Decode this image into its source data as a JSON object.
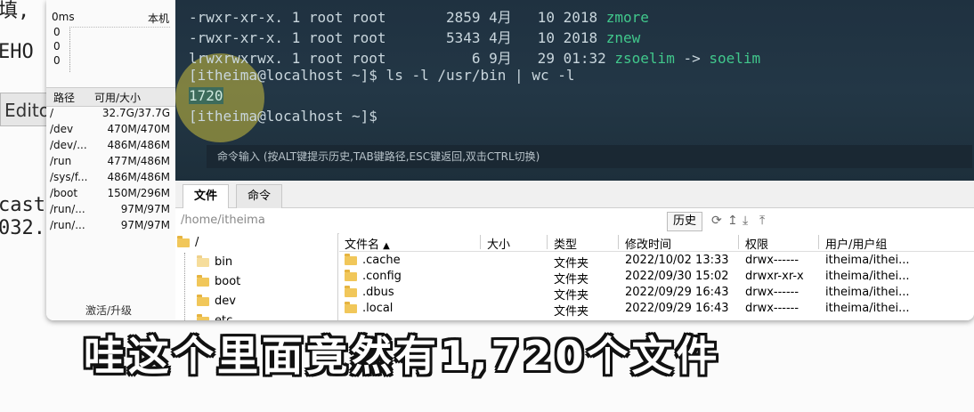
{
  "background": {
    "left_text": [
      "填,",
      "EHO",
      "cast",
      "032."
    ],
    "editor_btn": "Edito"
  },
  "sidebar": {
    "ms_label": "0ms",
    "ms_right": "本机",
    "spark_values": [
      "0",
      "0",
      "0"
    ],
    "headers": {
      "path": "路径",
      "size": "可用/大小"
    },
    "disks": [
      {
        "path": "/",
        "size": "32.7G/37.7G"
      },
      {
        "path": "/dev",
        "size": "470M/470M"
      },
      {
        "path": "/dev/...",
        "size": "486M/486M"
      },
      {
        "path": "/run",
        "size": "477M/486M"
      },
      {
        "path": "/sys/f...",
        "size": "486M/486M"
      },
      {
        "path": "/boot",
        "size": "150M/296M"
      },
      {
        "path": "/run/...",
        "size": "97M/97M"
      },
      {
        "path": "/run/...",
        "size": "97M/97M"
      }
    ],
    "upgrade": "激活/升级"
  },
  "terminal": {
    "lines": [
      {
        "prefix": "-rwxr-xr-x. 1 root root       2859 4月   10 2018 ",
        "name": "zmore"
      },
      {
        "prefix": "-rwxr-xr-x. 1 root root       5343 4月   10 2018 ",
        "name": "znew"
      },
      {
        "prefix": "lrwxrwxrwx. 1 root root          6 9月   29 01:32 ",
        "name": "zsoelim",
        "arrow": " -> ",
        "target": "soelim"
      }
    ],
    "prompt1": "[itheima@localhost ~]$ ls -l /usr/bin | wc -l",
    "output": "1720",
    "prompt2": "[itheima@localhost ~]$",
    "cmdbar": "命令输入 (按ALT键提示历史,TAB键路径,ESC键返回,双击CTRL切换)"
  },
  "tabs": [
    "文件",
    "命令"
  ],
  "pathbar": {
    "path": "/home/itheima",
    "history": "历史"
  },
  "tree": [
    "/",
    "bin",
    "boot",
    "dev",
    "etc"
  ],
  "list": {
    "headers": [
      "文件名",
      "大小",
      "类型",
      "修改时间",
      "权限",
      "用户/用户组"
    ],
    "rows": [
      {
        "name": ".cache",
        "type": "文件夹",
        "time": "2022/10/02 13:33",
        "perm": "drwx------",
        "owner": "itheima/ithei..."
      },
      {
        "name": ".config",
        "type": "文件夹",
        "time": "2022/09/30 15:02",
        "perm": "drwxr-xr-x",
        "owner": "itheima/ithei..."
      },
      {
        "name": ".dbus",
        "type": "文件夹",
        "time": "2022/09/29 16:43",
        "perm": "drwx------",
        "owner": "itheima/ithei..."
      },
      {
        "name": ".local",
        "type": "文件夹",
        "time": "2022/09/29 16:43",
        "perm": "drwx------",
        "owner": "itheima/ithei..."
      }
    ]
  },
  "subtitle": "哇这个里面竟然有1,720个文件"
}
